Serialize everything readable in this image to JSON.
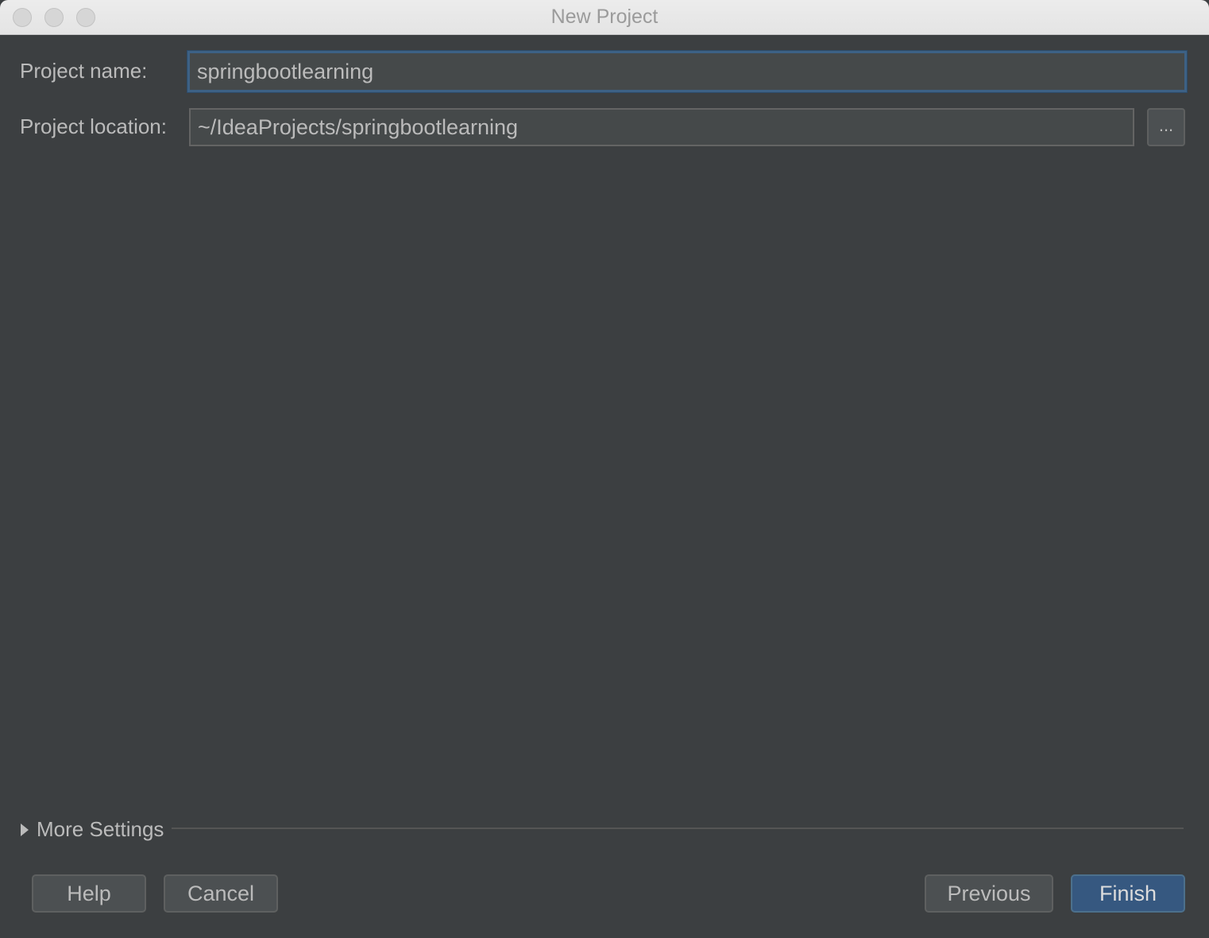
{
  "window": {
    "title": "New Project"
  },
  "form": {
    "project_name_label": "Project name:",
    "project_name_value": "springbootlearning",
    "project_location_label": "Project location:",
    "project_location_value": "~/IdeaProjects/springbootlearning",
    "browse_label": "..."
  },
  "more_settings": {
    "label": "More Settings",
    "expanded": false,
    "icon": "triangle-right-icon"
  },
  "buttons": {
    "help": "Help",
    "cancel": "Cancel",
    "previous": "Previous",
    "finish": "Finish"
  },
  "colors": {
    "background": "#3c3f41",
    "field_background": "#45494a",
    "focus_border": "#3d6185",
    "default_button": "#365880",
    "text": "#bbbbbb"
  }
}
